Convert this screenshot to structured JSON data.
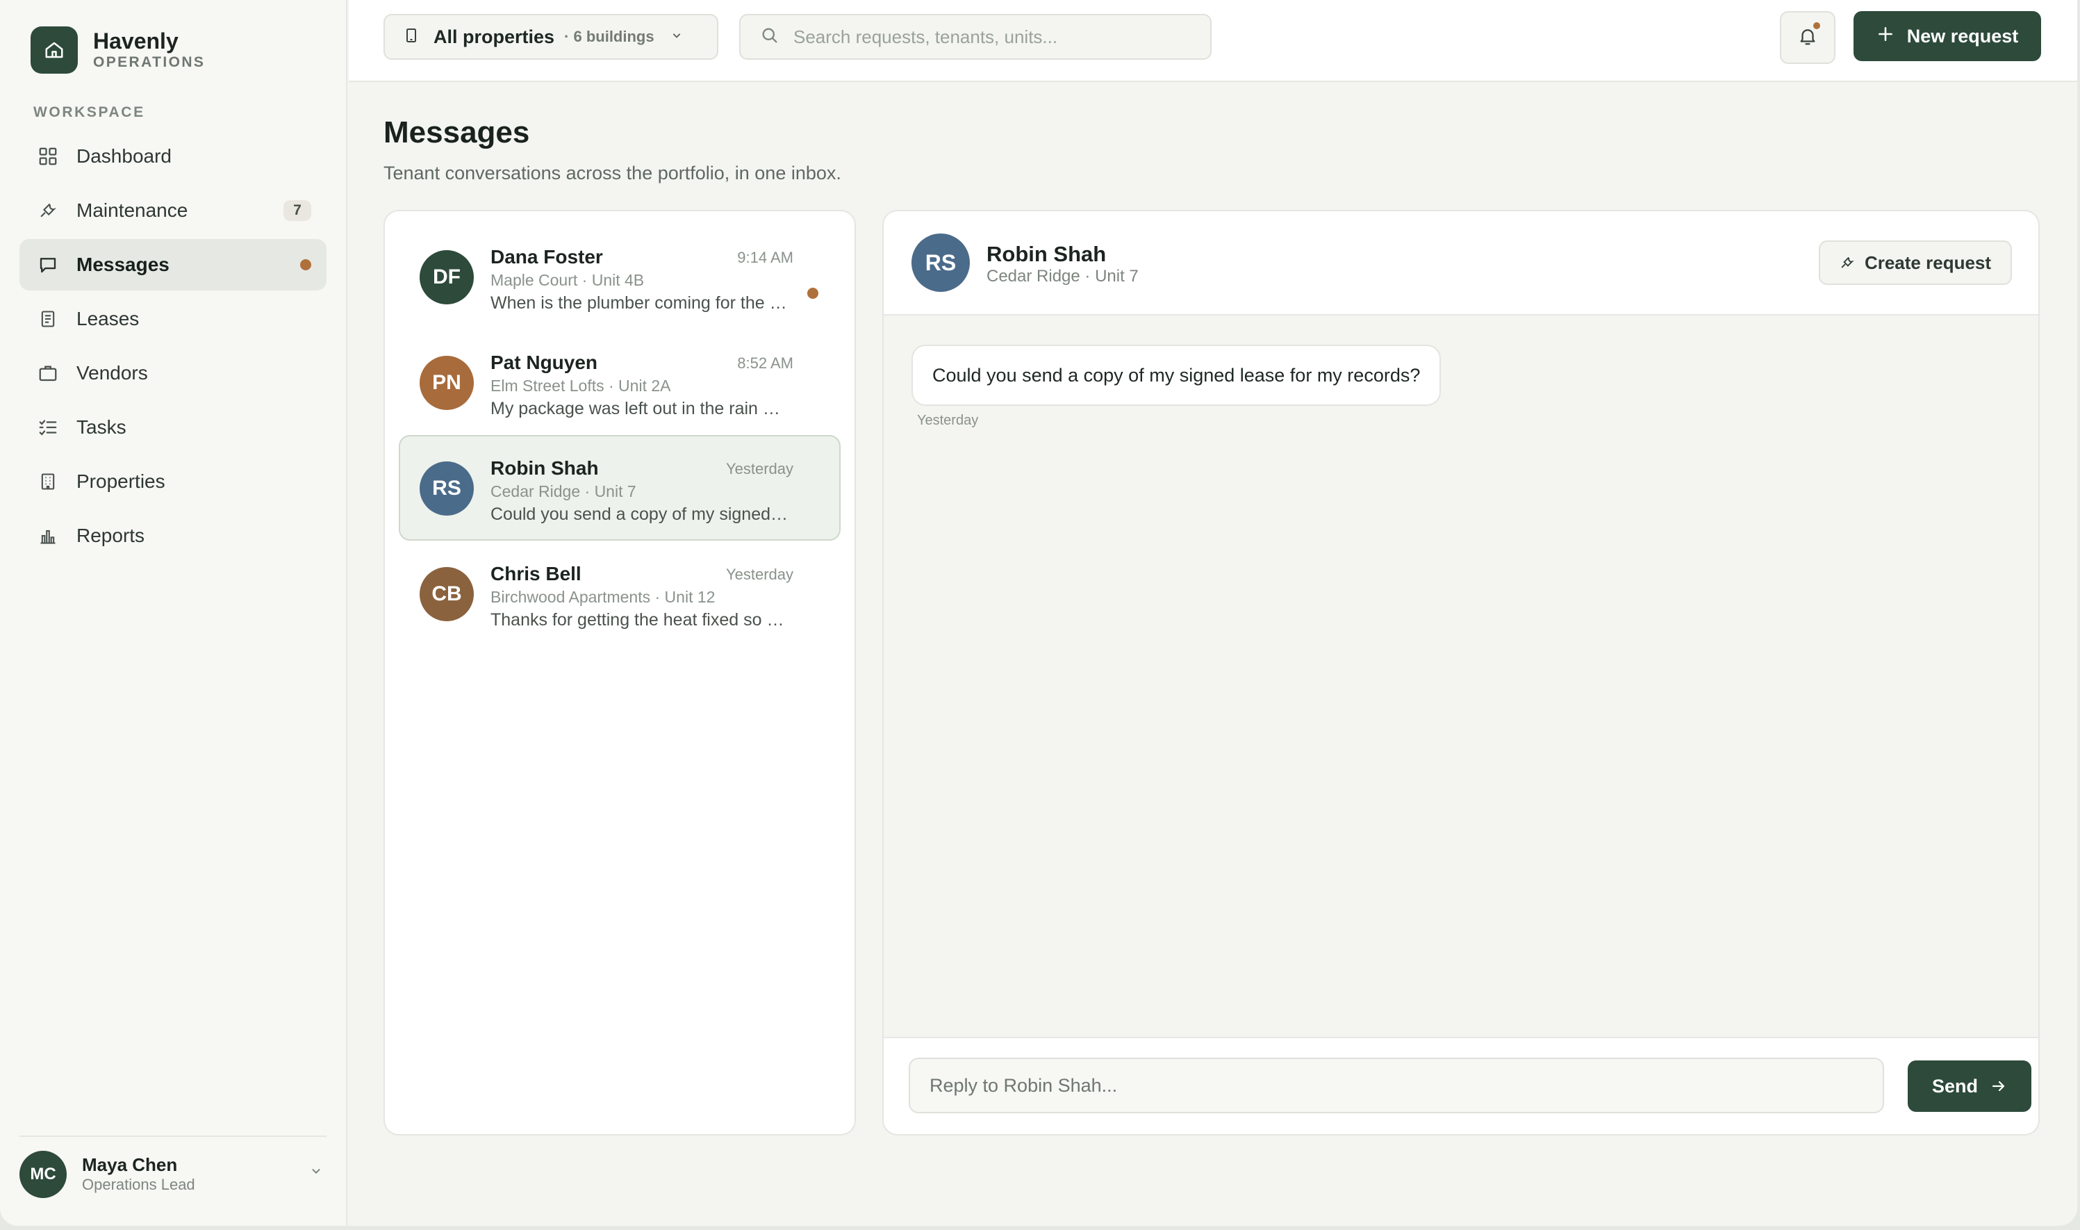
{
  "brand": {
    "name": "Havenly",
    "sub": "OPERATIONS",
    "icon": "home-icon"
  },
  "sidebar": {
    "section_label": "WORKSPACE",
    "items": [
      {
        "label": "Dashboard",
        "icon": "grid-icon"
      },
      {
        "label": "Maintenance",
        "icon": "wrench-icon",
        "badge": "7"
      },
      {
        "label": "Messages",
        "icon": "chat-icon",
        "active": true,
        "dot": true
      },
      {
        "label": "Leases",
        "icon": "document-icon"
      },
      {
        "label": "Vendors",
        "icon": "briefcase-icon"
      },
      {
        "label": "Tasks",
        "icon": "checklist-icon"
      },
      {
        "label": "Properties",
        "icon": "building-icon"
      },
      {
        "label": "Reports",
        "icon": "bar-chart-icon"
      }
    ]
  },
  "user": {
    "initials": "MC",
    "name": "Maya Chen",
    "role": "Operations Lead"
  },
  "topbar": {
    "property_label": "All properties",
    "property_sub": "· 6 buildings",
    "search_placeholder": "Search requests, tenants, units...",
    "new_request_label": "New request"
  },
  "page": {
    "title": "Messages",
    "subtitle": "Tenant conversations across the portfolio, in one inbox."
  },
  "conversations": [
    {
      "initials": "DF",
      "name": "Dana Foster",
      "location": "Maple Court · Unit 4B",
      "preview": "When is the plumber coming for the leak?",
      "time": "9:14 AM",
      "unread": true,
      "color": "#2d4a3a"
    },
    {
      "initials": "PN",
      "name": "Pat Nguyen",
      "location": "Elm Street Lofts · Unit 2A",
      "preview": "My package was left out in the rain again",
      "time": "8:52 AM",
      "color": "#a86b3b"
    },
    {
      "initials": "RS",
      "name": "Robin Shah",
      "location": "Cedar Ridge · Unit 7",
      "preview": "Could you send a copy of my signed lease?",
      "time": "Yesterday",
      "selected": true,
      "color": "#4b6b8a"
    },
    {
      "initials": "CB",
      "name": "Chris Bell",
      "location": "Birchwood Apartments · Unit 12",
      "preview": "Thanks for getting the heat fixed so quickly",
      "time": "Yesterday",
      "color": "#8a623e"
    }
  ],
  "thread": {
    "initials": "RS",
    "name": "Robin Shah",
    "location": "Cedar Ridge · Unit 7",
    "create_request_label": "Create request",
    "message": "Could you send a copy of my signed lease for my records?",
    "message_time": "Yesterday",
    "reply_placeholder": "Reply to Robin Shah...",
    "send_label": "Send"
  }
}
